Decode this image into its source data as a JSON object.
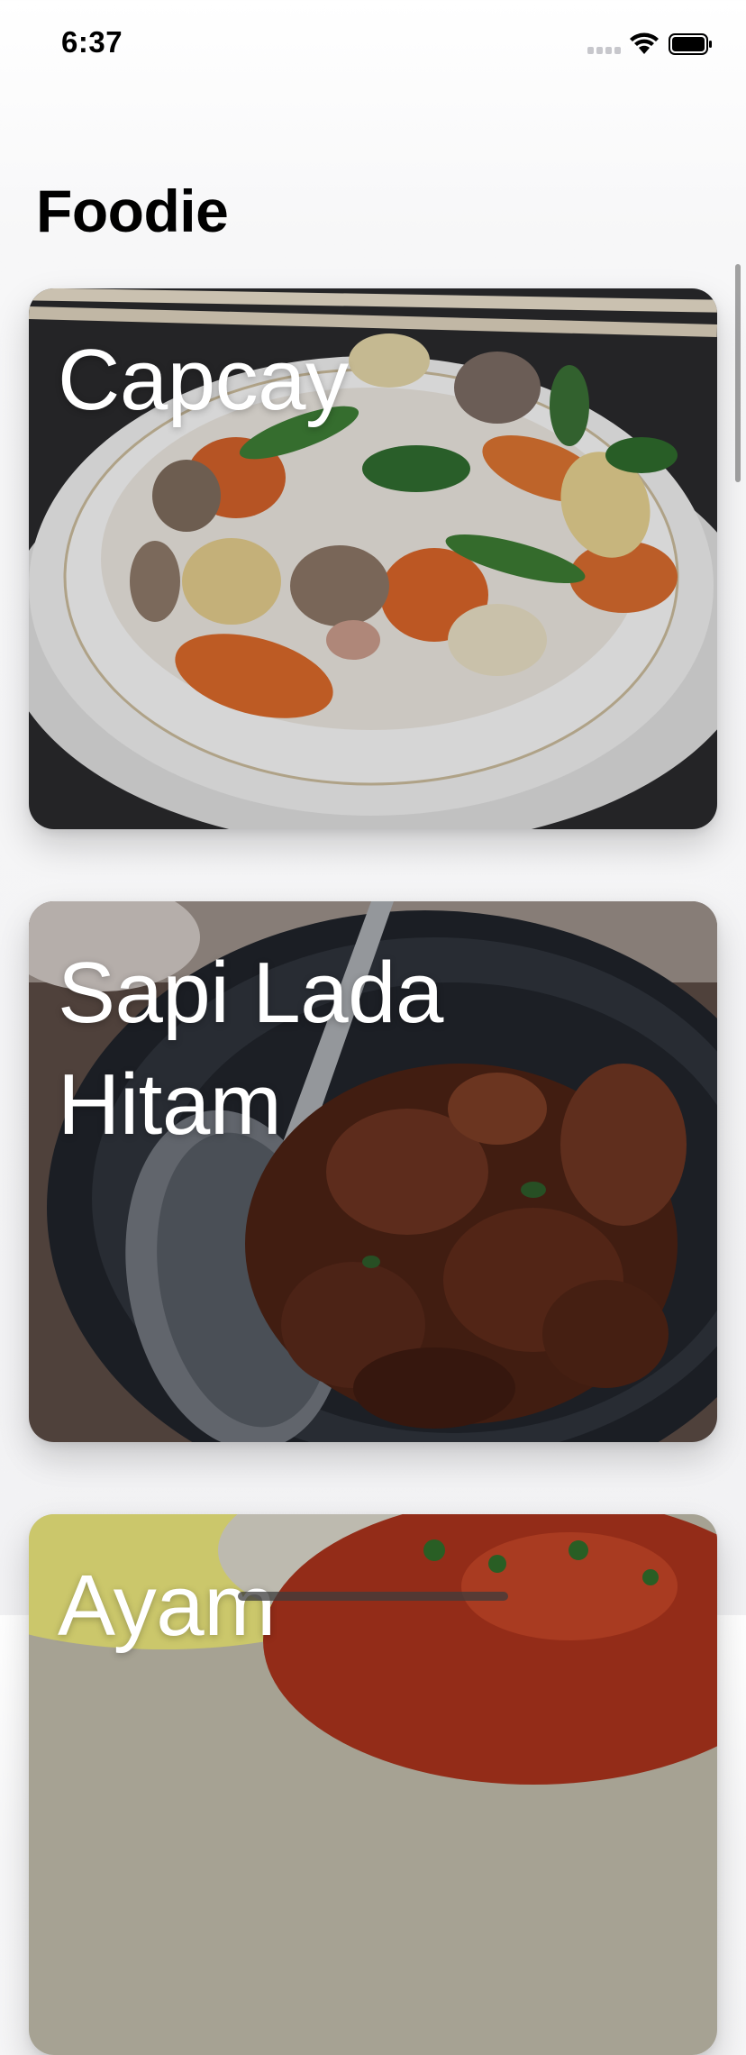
{
  "status_bar": {
    "time": "6:37"
  },
  "header": {
    "title": "Foodie"
  },
  "cards": [
    {
      "title": "Capcay",
      "image_icon": "vegetable-stirfry-photo"
    },
    {
      "title": "Sapi Lada Hitam",
      "image_icon": "black-pepper-beef-photo"
    },
    {
      "title": "Ayam",
      "image_icon": "chicken-dish-photo"
    }
  ],
  "colors": {
    "background": "#f2f2f4",
    "card_title": "#ffffff"
  }
}
